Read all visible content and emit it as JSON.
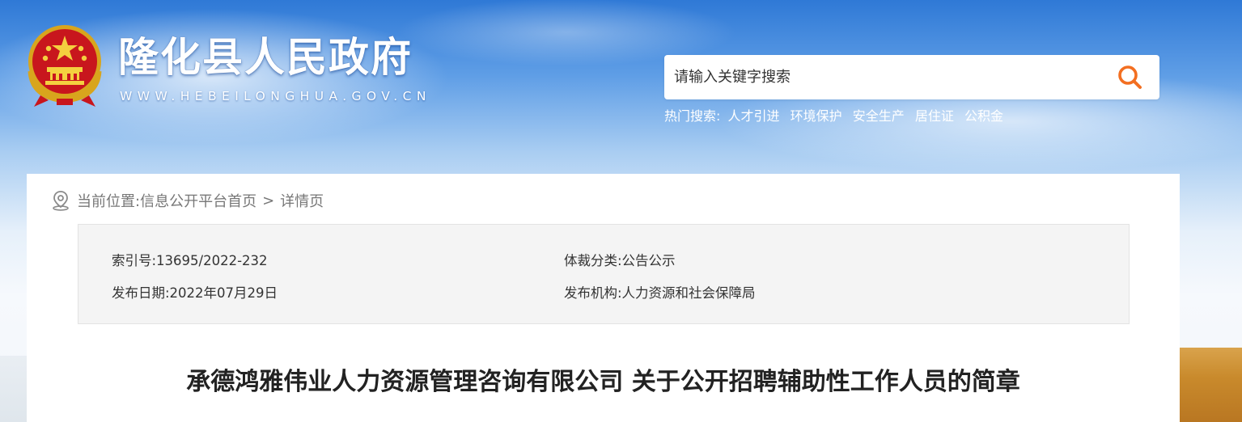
{
  "header": {
    "site_title": "隆化县人民政府",
    "site_url": "WWW.HEBEILONGHUA.GOV.CN",
    "emblem_icon": "national-emblem-icon"
  },
  "search": {
    "placeholder": "请输入关键字搜索",
    "value": "",
    "button_icon": "search-icon",
    "accent_color": "#f36f21"
  },
  "hot_search": {
    "label": "热门搜索:",
    "items": [
      "人才引进",
      "环境保护",
      "安全生产",
      "居住证",
      "公积金"
    ]
  },
  "breadcrumb": {
    "icon": "location-pin-icon",
    "label": "当前位置:",
    "home": "信息公开平台首页",
    "separator": ">",
    "current": "详情页"
  },
  "meta": {
    "index_no": "索引号:13695/2022-232",
    "category": "体裁分类:公告公示",
    "publish_date": "发布日期:2022年07月29日",
    "publisher": "发布机构:人力资源和社会保障局"
  },
  "article": {
    "title": "承德鸿雅伟业人力资源管理咨询有限公司 关于公开招聘辅助性工作人员的简章"
  }
}
